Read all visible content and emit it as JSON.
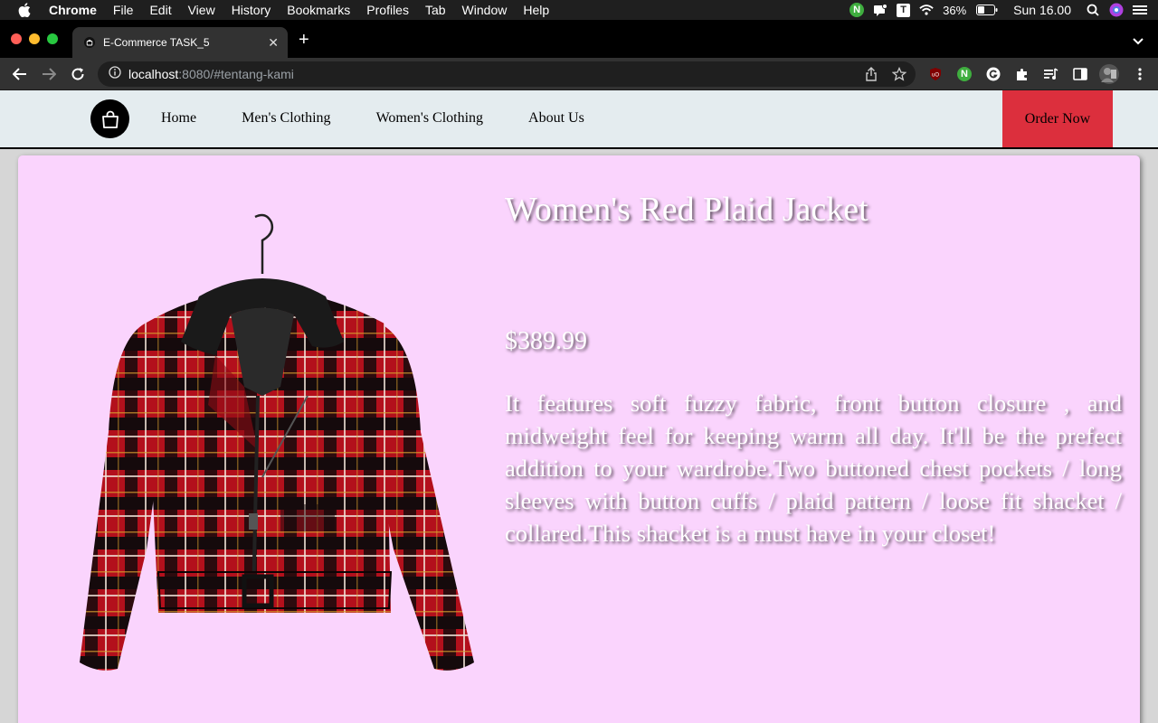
{
  "menubar": {
    "app_name": "Chrome",
    "items": [
      "File",
      "Edit",
      "View",
      "History",
      "Bookmarks",
      "Profiles",
      "Tab",
      "Window",
      "Help"
    ],
    "battery": "36%",
    "clock": "Sun 16.00",
    "icon_n": "N",
    "icon_t": "T"
  },
  "browser": {
    "tab_title": "E-Commerce TASK_5",
    "url_host": "localhost",
    "url_rest": ":8080/#tentang-kami",
    "ext_n": "N"
  },
  "site": {
    "nav": [
      "Home",
      "Men's Clothing",
      "Women's Clothing",
      "About Us"
    ],
    "order_button": "Order Now"
  },
  "product": {
    "title": "Women's Red Plaid Jacket",
    "price": "$389.99",
    "description": "It features soft fuzzy fabric, front button closure , and midweight feel for keeping warm all day. It'll be the prefect addition to your wardrobe.Two buttoned chest pockets / long sleeves with button cuffs / plaid pattern / loose fit shacket / collared.This shacket is a must have in your closet!"
  },
  "colors": {
    "order_button": "#dc2f3d",
    "card_bg": "#fad4fd",
    "nav_bg": "#e4ecef"
  }
}
